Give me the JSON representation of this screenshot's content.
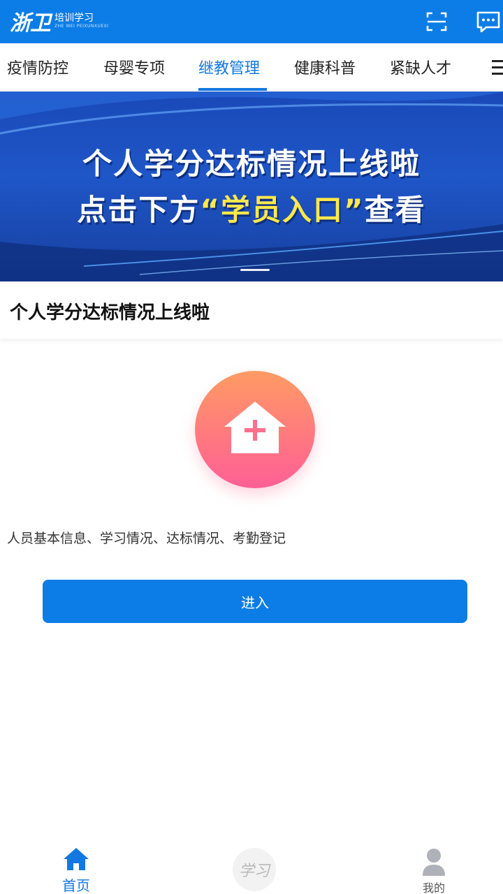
{
  "header": {
    "logo_mark": "浙卫",
    "logo_text": "培训学习",
    "logo_pinyin": "ZHE WEI PEIXUNXUEXI",
    "icons": [
      "scan-icon",
      "message-icon"
    ],
    "accent": "#0c7de6"
  },
  "tabs": [
    {
      "label": "疫情防控",
      "active": false
    },
    {
      "label": "母婴专项",
      "active": false
    },
    {
      "label": "继教管理",
      "active": true
    },
    {
      "label": "健康科普",
      "active": false
    },
    {
      "label": "紧缺人才",
      "active": false
    }
  ],
  "banner": {
    "line1": "个人学分达标情况上线啦",
    "line2_prefix": "点击下方",
    "line2_highlight": "“学员入口”",
    "line2_suffix": "查看",
    "highlight_color": "#ffe84a"
  },
  "article": {
    "title": "个人学分达标情况上线啦"
  },
  "entry": {
    "icon": "house-plus-icon",
    "description": "人员基本信息、学习情况、达标情况、考勤登记",
    "button_label": "进入"
  },
  "bottom_nav": {
    "home_label": "首页",
    "study_label": "学习",
    "mine_label": "我的"
  }
}
